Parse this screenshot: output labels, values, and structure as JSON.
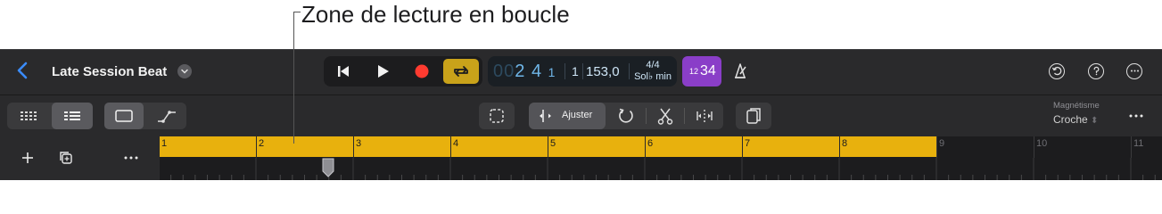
{
  "annotation": {
    "label": "Zone de lecture en boucle"
  },
  "project": {
    "title": "Late Session Beat"
  },
  "lcd": {
    "bar": "2",
    "beat": "4",
    "division": "1",
    "tick": "1",
    "tempo": "153,0",
    "time_signature": "4/4",
    "key": "Sol♭ min"
  },
  "count_in": {
    "small": "12",
    "big": "34"
  },
  "toolbar": {
    "ajuster_label": "Ajuster"
  },
  "snap": {
    "label": "Magnétisme",
    "value": "Croche"
  },
  "ruler": {
    "bars": [
      "1",
      "2",
      "3",
      "4",
      "5",
      "6",
      "7",
      "8",
      "9",
      "10",
      "11"
    ],
    "cycle_start_bar": 1,
    "cycle_end_bar": 9
  },
  "colors": {
    "accent": "#3b8cff",
    "cycle": "#e8b10d",
    "record": "#ff3b30",
    "count_in": "#8a3ec8",
    "loop_active": "#c9a21a"
  },
  "icons": [
    "back-chevron-icon",
    "title-menu-chevron-icon",
    "go-to-start-icon",
    "play-icon",
    "record-icon",
    "loop-icon",
    "metronome-icon",
    "undo-history-icon",
    "help-icon",
    "more-icon",
    "grid-view-icon",
    "list-view-icon",
    "rectangle-icon",
    "automation-curve-icon",
    "marquee-select-icon",
    "repeat-icon",
    "scissors-icon",
    "join-icon",
    "clipboard-icon",
    "add-icon",
    "duplicate-icon"
  ]
}
